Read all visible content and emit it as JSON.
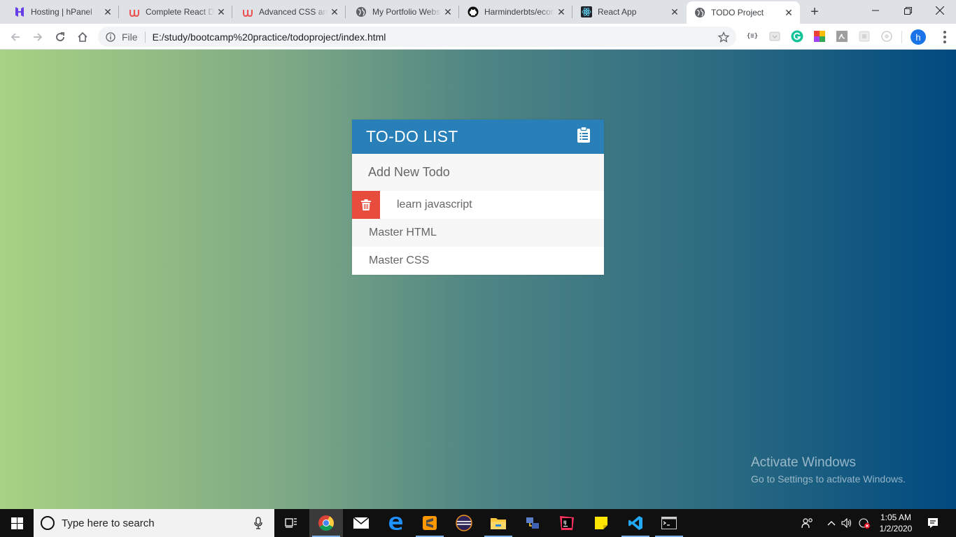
{
  "browser": {
    "tabs": [
      {
        "title": "Hosting | hPanel",
        "icon": "hostinger-icon"
      },
      {
        "title": "Complete React Developer",
        "icon": "udemy-icon"
      },
      {
        "title": "Advanced CSS and Sass",
        "icon": "udemy-icon"
      },
      {
        "title": "My Portfolio Website",
        "icon": "globe-icon"
      },
      {
        "title": "Harminderbts/ecommerce",
        "icon": "github-icon"
      },
      {
        "title": "React App",
        "icon": "react-icon"
      },
      {
        "title": "TODO Project",
        "icon": "globe-icon",
        "active": true
      }
    ],
    "omnibox": {
      "scheme_label": "File",
      "url": "E:/study/bootcamp%20practice/todoproject/index.html"
    },
    "profile_initial": "h",
    "extensions": [
      "json-icon",
      "pocket-icon",
      "grammarly-icon",
      "color-picker-icon",
      "pdf-icon",
      "extension-icon",
      "timer-icon"
    ]
  },
  "todo": {
    "title": "TO-DO LIST",
    "header_icon": "clipboard-icon",
    "input_placeholder": "Add New Todo",
    "items": [
      {
        "text": "learn javascript",
        "delete_visible": true
      },
      {
        "text": "Master HTML",
        "delete_visible": false
      },
      {
        "text": "Master CSS",
        "delete_visible": false
      }
    ],
    "colors": {
      "header": "#2980b9",
      "delete": "#e74c3c",
      "gradient_start": "#a8d283",
      "gradient_end": "#004a80"
    }
  },
  "watermark": {
    "line1": "Activate Windows",
    "line2": "Go to Settings to activate Windows."
  },
  "taskbar": {
    "search_placeholder": "Type here to search",
    "apps": [
      "task-view-icon",
      "chrome-icon",
      "mail-icon",
      "edge-icon",
      "sublime-icon",
      "eclipse-icon",
      "file-explorer-icon",
      "network-app-icon",
      "intellij-icon",
      "sticky-notes-icon",
      "vscode-icon",
      "terminal-icon"
    ],
    "time": "1:05 AM",
    "date": "1/2/2020"
  }
}
